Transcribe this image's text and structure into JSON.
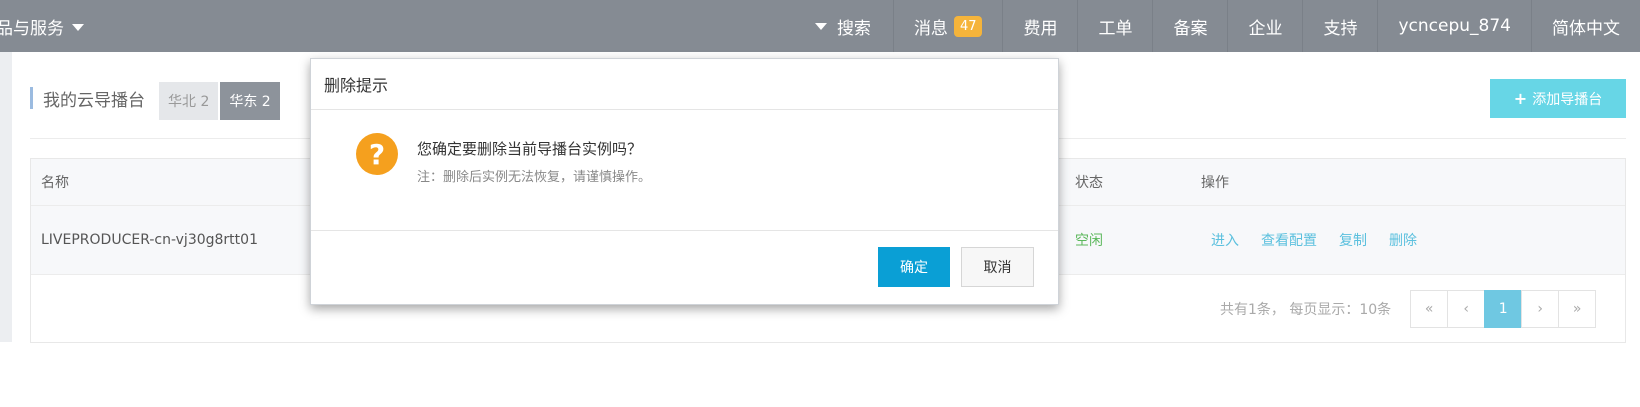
{
  "topnav": {
    "products_label": "品与服务",
    "search_label": "搜索",
    "messages_label": "消息",
    "messages_count": "47",
    "billing_label": "费用",
    "tickets_label": "工单",
    "icp_label": "备案",
    "enterprise_label": "企业",
    "support_label": "支持",
    "username": "ycncepu_874",
    "language": "简体中文"
  },
  "page": {
    "title": "我的云导播台",
    "regions": [
      "华北 2",
      "华东 2"
    ],
    "active_region": "华东 2",
    "add_button_label": "添加导播台"
  },
  "table": {
    "columns": {
      "name": "名称",
      "status": "状态",
      "actions": "操作"
    },
    "rows": [
      {
        "name": "LIVEPRODUCER-cn-vj30g8rtt01",
        "status": "空闲",
        "actions": [
          "进入",
          "查看配置",
          "复制",
          "删除"
        ]
      }
    ]
  },
  "pagination": {
    "info": "共有1条， 每页显示：10条",
    "first": "«",
    "prev": "‹",
    "current": "1",
    "next": "›",
    "last": "»"
  },
  "modal": {
    "title": "删除提示",
    "icon": "question-icon",
    "message": "您确定要删除当前导播台实例吗？",
    "note": "注：删除后实例无法恢复，请谨慎操作。",
    "confirm_label": "确定",
    "cancel_label": "取消"
  },
  "colors": {
    "topbar": "#858b93",
    "primary": "#0a9fd5",
    "accent_cyan": "#67d6e6",
    "warning": "#f5a01e",
    "status_idle": "#5cb85c",
    "link": "#5bc0de"
  }
}
